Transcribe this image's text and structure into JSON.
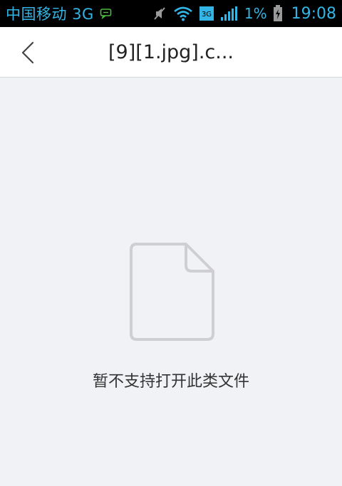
{
  "status_bar": {
    "carrier": "中国移动 3G",
    "network_badge": "3G",
    "battery": "1%",
    "time": "19:08",
    "icons": [
      "message-icon",
      "mute-icon",
      "wifi-icon",
      "network-3g-icon",
      "signal-icon",
      "battery-icon"
    ],
    "accent_color": "#33b5e5"
  },
  "header": {
    "back_icon": "chevron-left-icon",
    "title": "[9][1.jpg].c..."
  },
  "content": {
    "file_icon": "document-icon",
    "message": "暂不支持打开此类文件"
  }
}
